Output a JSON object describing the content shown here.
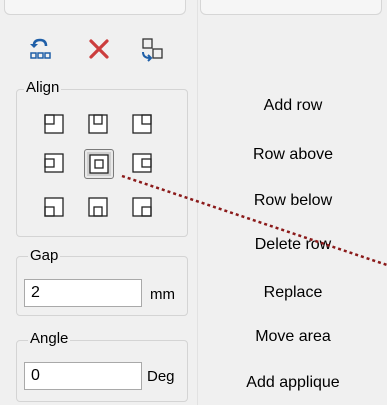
{
  "toolbar": {
    "icons": [
      "undo-area-icon",
      "delete-icon",
      "copy-area-icon"
    ]
  },
  "align": {
    "label": "Align",
    "selected": "center",
    "positions": [
      "top-left",
      "top-center",
      "top-right",
      "middle-left",
      "center",
      "middle-right",
      "bottom-left",
      "bottom-center",
      "bottom-right"
    ]
  },
  "gap": {
    "label": "Gap",
    "value": "2",
    "unit": "mm"
  },
  "angle": {
    "label": "Angle",
    "value": "0",
    "unit": "Deg"
  },
  "actions": [
    "Add row",
    "Row above",
    "Row below",
    "Delete row",
    "Replace",
    "Move area",
    "Add applique"
  ],
  "colors": {
    "accent_blue": "#1f5fa8",
    "delete_red": "#cc3d3d",
    "guide_line": "#8b1a1a"
  }
}
